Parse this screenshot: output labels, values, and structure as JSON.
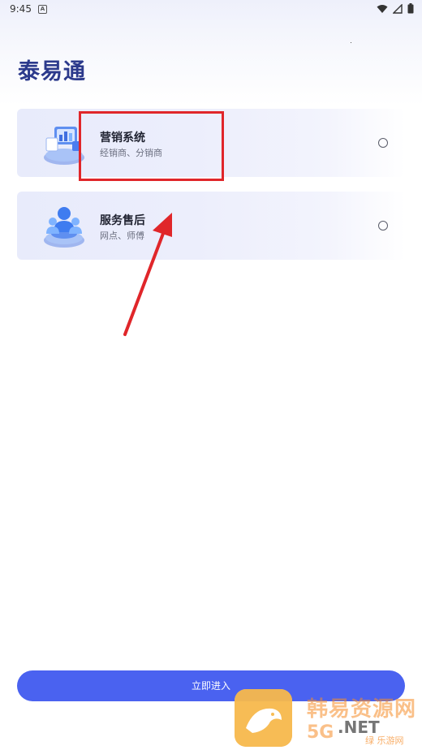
{
  "status_bar": {
    "time": "9:45",
    "badge": "A"
  },
  "app": {
    "title": "泰易通"
  },
  "options": [
    {
      "title": "营销系统",
      "subtitle": "经销商、分销商",
      "icon": "marketing-system-icon",
      "selected": false
    },
    {
      "title": "服务售后",
      "subtitle": "网点、师傅",
      "icon": "after-sales-service-icon",
      "selected": false
    }
  ],
  "enter_button": {
    "label": "立即进入"
  },
  "watermark": {
    "text": "韩易资源网",
    "net": ".NET",
    "num": "5G",
    "sub": "绿 乐游网"
  },
  "colors": {
    "accent": "#4a62f0",
    "title": "#2c3a8c",
    "annotation": "#e0262a"
  }
}
